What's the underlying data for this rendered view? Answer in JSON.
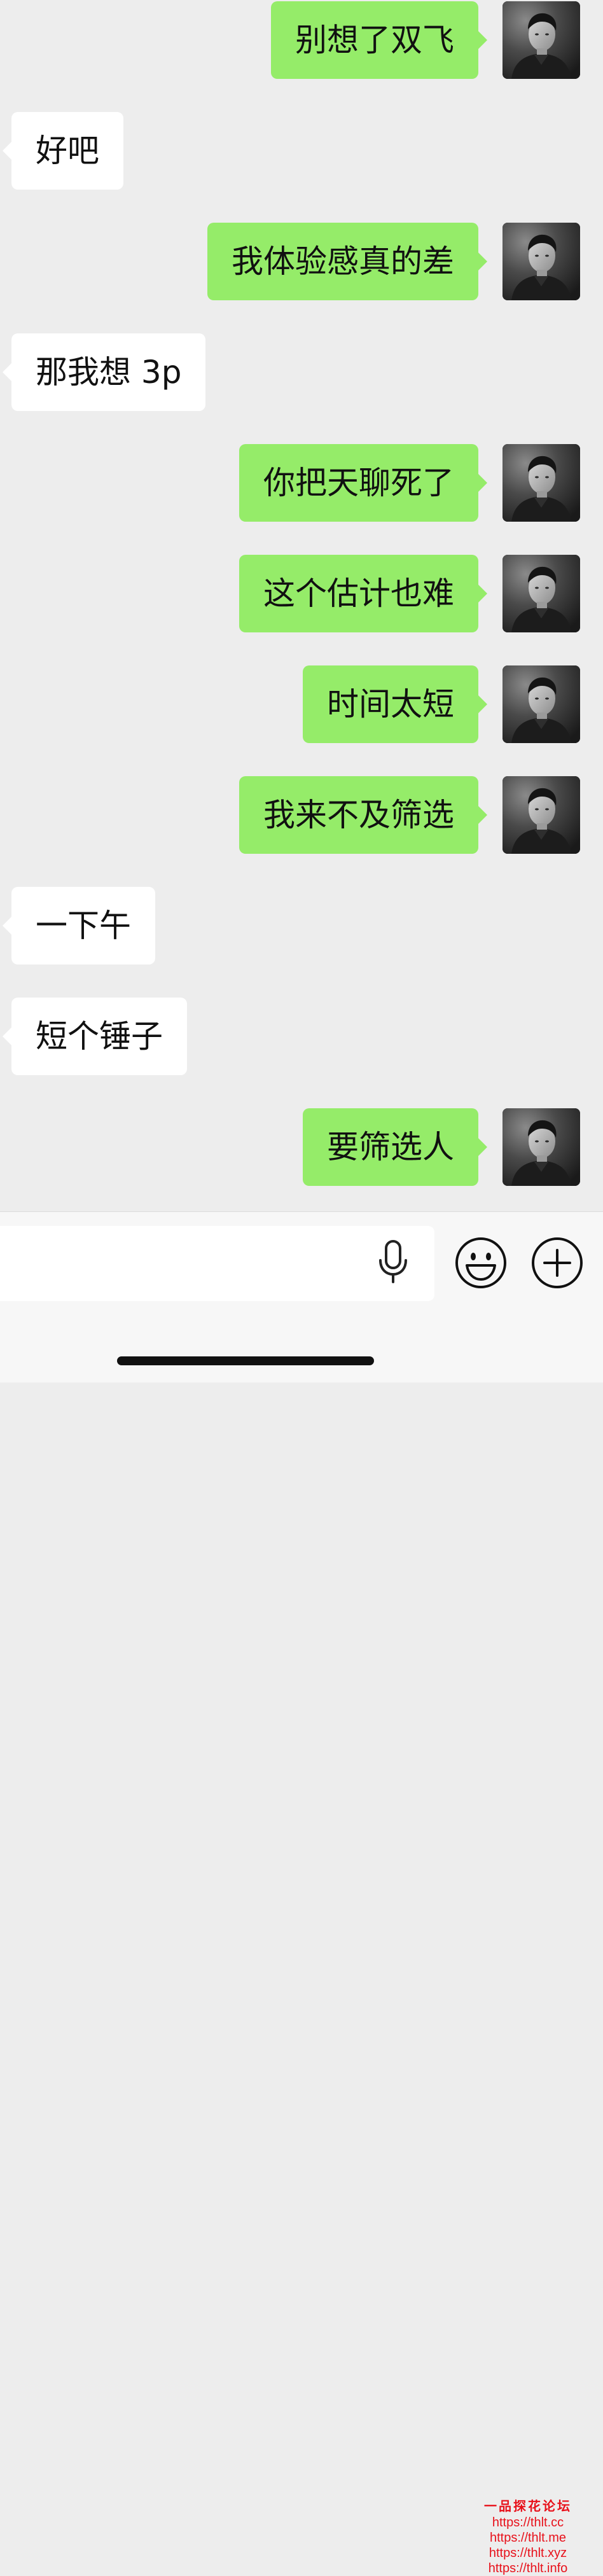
{
  "messages": [
    {
      "direction": "sent",
      "text": "别想了双飞"
    },
    {
      "direction": "received",
      "text": "好吧"
    },
    {
      "direction": "sent",
      "text": "我体验感真的差"
    },
    {
      "direction": "received",
      "text": "那我想 3p"
    },
    {
      "direction": "sent",
      "text": "你把天聊死了"
    },
    {
      "direction": "sent",
      "text": "这个估计也难"
    },
    {
      "direction": "sent",
      "text": "时间太短"
    },
    {
      "direction": "sent",
      "text": "我来不及筛选"
    },
    {
      "direction": "received",
      "text": "一下午"
    },
    {
      "direction": "received",
      "text": "短个锤子"
    },
    {
      "direction": "sent",
      "text": "要筛选人"
    }
  ],
  "input_bar": {
    "voice_icon": "microphone-icon",
    "emoji_icon": "smiley-icon",
    "more_icon": "plus-circle-icon"
  },
  "watermark": {
    "title": "一品探花论坛",
    "links": [
      "https://thlt.cc",
      "https://thlt.me",
      "https://thlt.xyz",
      "https://thlt.info"
    ]
  },
  "colors": {
    "background": "#ededed",
    "sent_bubble": "#95ec69",
    "received_bubble": "#ffffff",
    "watermark": "#e8101a"
  }
}
